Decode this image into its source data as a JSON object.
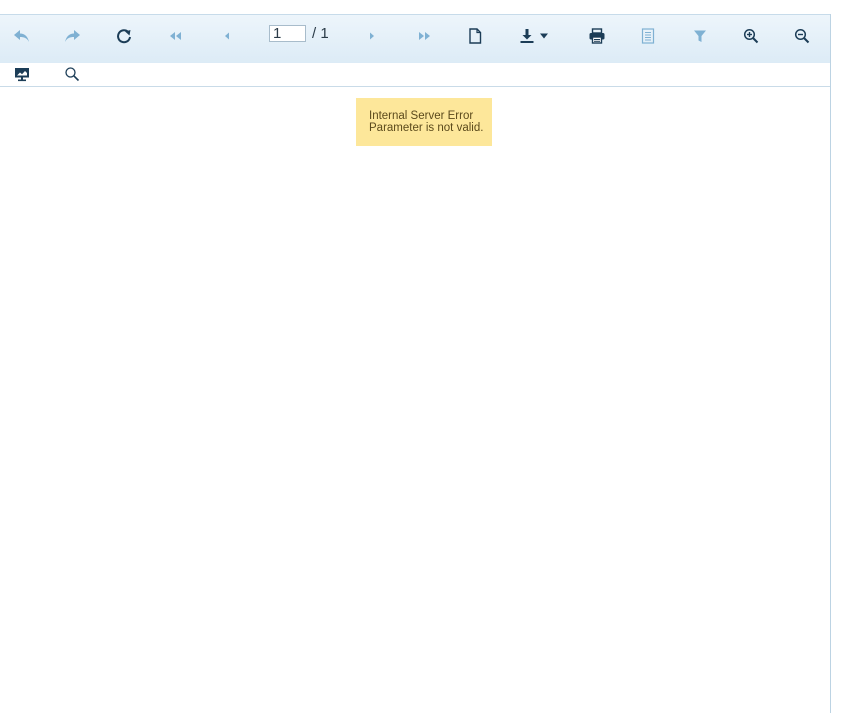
{
  "toolbar": {
    "buttons": [
      {
        "name": "undo-button",
        "icon": "undo-arrow-icon",
        "enabled": false
      },
      {
        "name": "redo-button",
        "icon": "redo-arrow-icon",
        "enabled": false
      },
      {
        "name": "refresh-button",
        "icon": "refresh-icon",
        "enabled": true
      },
      {
        "name": "first-page-button",
        "icon": "double-chevron-left-icon",
        "enabled": false
      },
      {
        "name": "previous-page-button",
        "icon": "chevron-left-icon",
        "enabled": false
      },
      {
        "name": "next-page-button",
        "icon": "chevron-right-icon",
        "enabled": false
      },
      {
        "name": "last-page-button",
        "icon": "double-chevron-right-icon",
        "enabled": false
      },
      {
        "name": "page-setup-button",
        "icon": "document-icon",
        "enabled": true
      },
      {
        "name": "export-button",
        "icon": "download-icon",
        "enabled": true
      },
      {
        "name": "print-button",
        "icon": "printer-icon",
        "enabled": true
      },
      {
        "name": "print-layout-button",
        "icon": "page-layout-icon",
        "enabled": false
      },
      {
        "name": "parameters-button",
        "icon": "filter-icon",
        "enabled": false
      },
      {
        "name": "zoom-in-button",
        "icon": "zoom-in-icon",
        "enabled": true
      },
      {
        "name": "zoom-out-button",
        "icon": "zoom-out-icon",
        "enabled": true
      }
    ],
    "page_current": "1",
    "page_total": "/ 1"
  },
  "toolbar2": {
    "buttons": [
      {
        "name": "view-mode-button",
        "icon": "monitor-icon",
        "enabled": true
      },
      {
        "name": "search-button",
        "icon": "search-icon",
        "enabled": true
      }
    ]
  },
  "error": {
    "line1": "Internal Server Error",
    "line2": "Parameter is not valid."
  },
  "colors": {
    "icon_active": "#1c3d57",
    "icon_disabled": "#7fb1d3",
    "toolbar_bg": "#dcebf6",
    "error_bg": "#fde79a"
  }
}
